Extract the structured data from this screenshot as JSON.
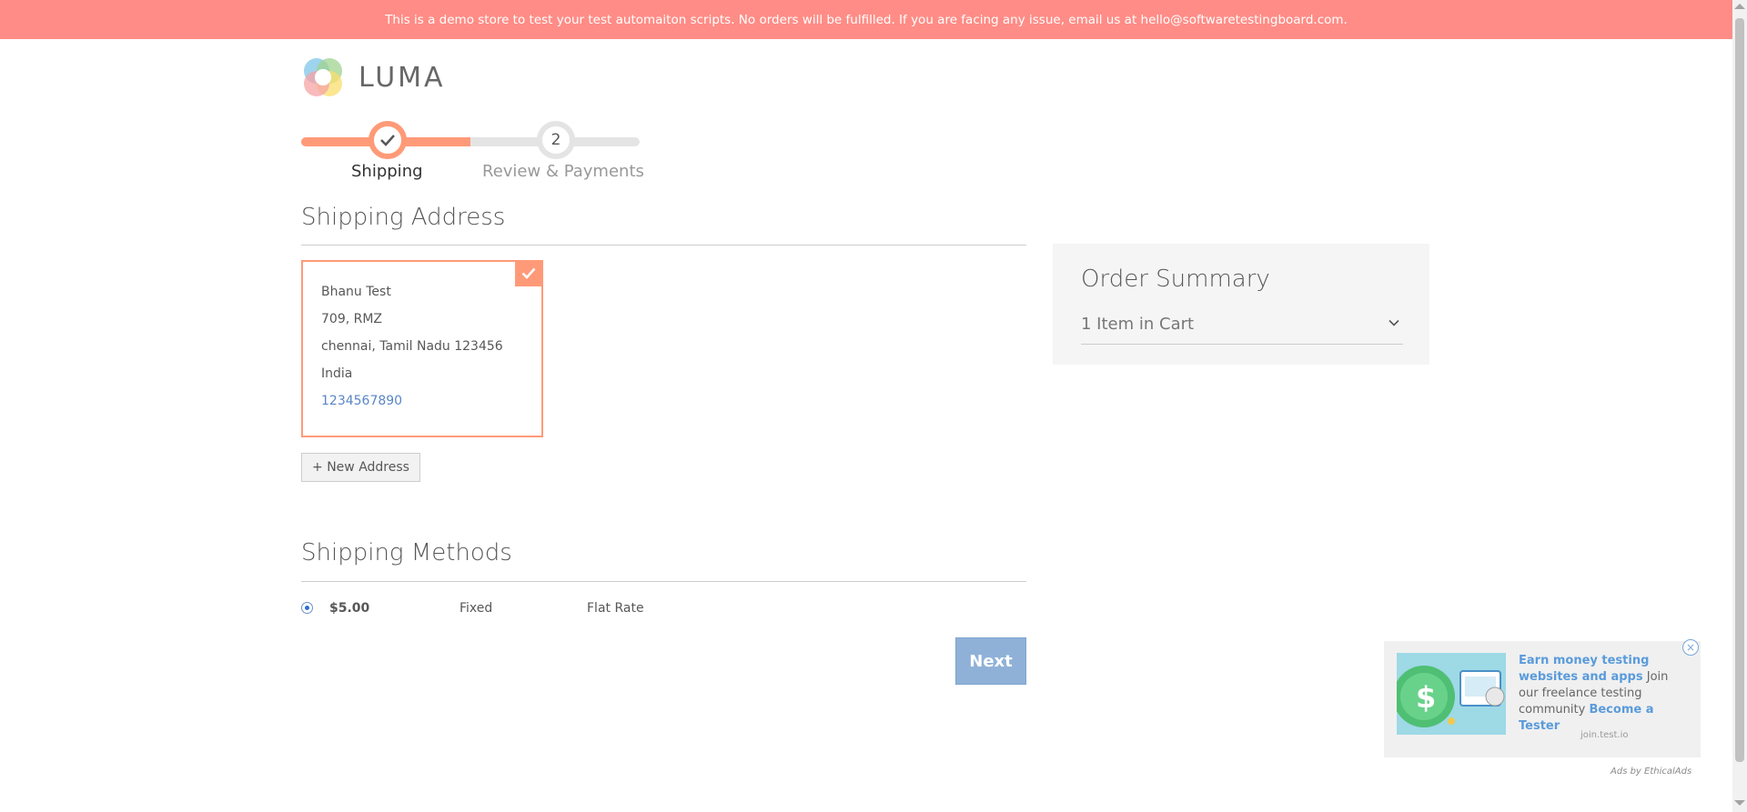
{
  "banner": {
    "text": "This is a demo store to test your test automaiton scripts. No orders will be fulfilled. If you are facing any issue, email us at hello@softwaretestingboard.com."
  },
  "logo": {
    "text": "LUMA"
  },
  "progress": {
    "steps": [
      {
        "label": "Shipping",
        "state": "complete",
        "icon": "check-icon"
      },
      {
        "label": "Review & Payments",
        "number": "2",
        "state": "pending"
      }
    ],
    "fill_fraction": 0.5
  },
  "shipping_address": {
    "title": "Shipping Address",
    "selected_address": {
      "name": "Bhanu Test",
      "street": "709, RMZ",
      "city_region_zip": "chennai, Tamil Nadu 123456",
      "country": "India",
      "phone": "1234567890"
    },
    "new_address_label": "+ New Address"
  },
  "shipping_methods": {
    "title": "Shipping Methods",
    "options": [
      {
        "price": "$5.00",
        "method": "Fixed",
        "carrier": "Flat Rate",
        "selected": true
      }
    ]
  },
  "actions": {
    "next_label": "Next"
  },
  "order_summary": {
    "title": "Order Summary",
    "cart_count_label": "1 Item in Cart"
  },
  "ad": {
    "headline": "Earn money testing websites and apps",
    "body": " Join our freelance testing community ",
    "cta": "Become a Tester",
    "domain": "join.test.io",
    "attribution": "Ads by EthicalAds"
  },
  "colors": {
    "banner": "#ff8c86",
    "accent": "#ff9a78",
    "next_button": "#8fb1d8",
    "link": "#5a86c4"
  }
}
